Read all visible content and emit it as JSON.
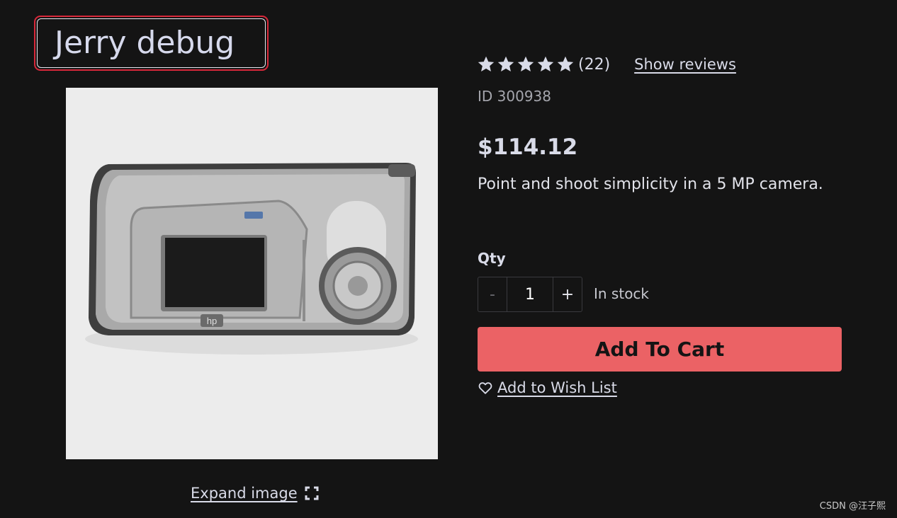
{
  "product": {
    "title": "Jerry debug",
    "image_alt": "Digital camera",
    "expand_label": "Expand image",
    "rating": {
      "stars_filled": 5,
      "stars_total": 5,
      "count_label": "(22)",
      "show_reviews_label": "Show reviews"
    },
    "id_label": "ID 300938",
    "price": "$114.12",
    "description": "Point and shoot simplicity in a 5 MP camera.",
    "qty": {
      "label": "Qty",
      "minus": "-",
      "value": "1",
      "plus": "+"
    },
    "stock_status": "In stock",
    "add_to_cart_label": "Add To Cart",
    "wishlist_label": "Add to Wish List"
  },
  "colors": {
    "background": "#141414",
    "accent": "#eb6265",
    "title_highlight": "#d8283a"
  },
  "icons": {
    "star": "star-icon",
    "expand": "expand-icon",
    "heart": "heart-icon"
  },
  "watermark": "CSDN @汪子熙"
}
